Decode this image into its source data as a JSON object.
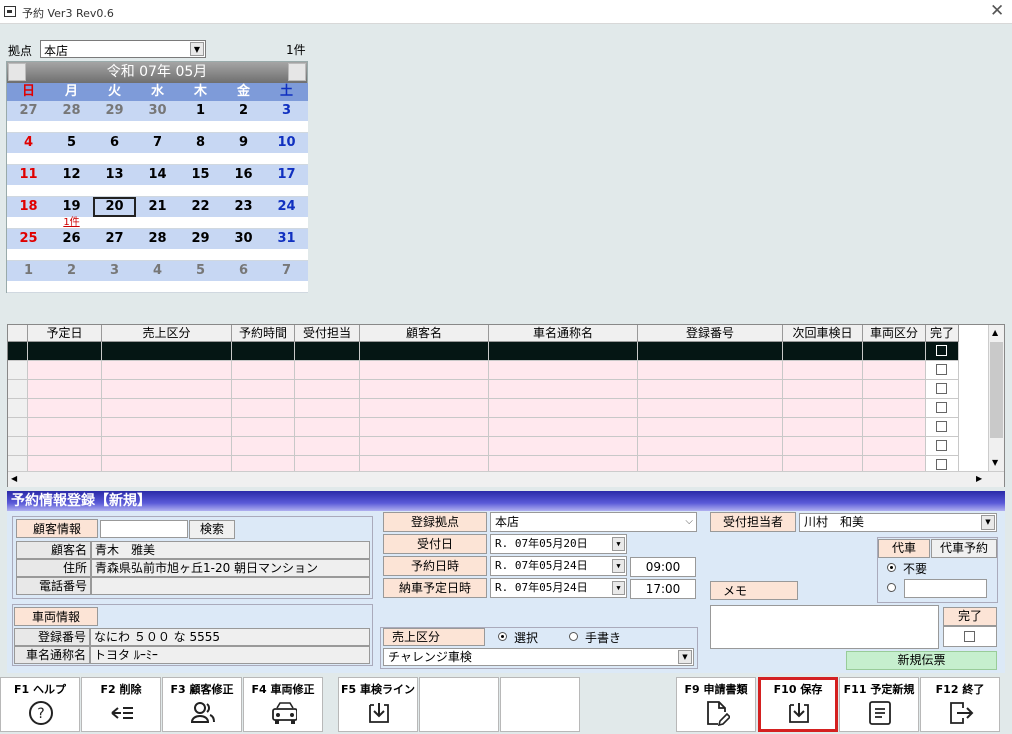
{
  "window": {
    "title": "予約 Ver3 Rev0.6",
    "close": "✕"
  },
  "top": {
    "branch_label": "拠点",
    "branch_value": "本店",
    "count": "1件"
  },
  "calendar": {
    "title": "令和 07年 05月",
    "dow": [
      "日",
      "月",
      "火",
      "水",
      "木",
      "金",
      "土"
    ],
    "weeks": [
      [
        {
          "d": "27",
          "o": 1
        },
        {
          "d": "28",
          "o": 1
        },
        {
          "d": "29",
          "o": 1
        },
        {
          "d": "30",
          "o": 1
        },
        {
          "d": "1"
        },
        {
          "d": "2"
        },
        {
          "d": "3"
        }
      ],
      [
        {
          "d": "4"
        },
        {
          "d": "5"
        },
        {
          "d": "6"
        },
        {
          "d": "7"
        },
        {
          "d": "8"
        },
        {
          "d": "9"
        },
        {
          "d": "10"
        }
      ],
      [
        {
          "d": "11"
        },
        {
          "d": "12"
        },
        {
          "d": "13"
        },
        {
          "d": "14"
        },
        {
          "d": "15"
        },
        {
          "d": "16"
        },
        {
          "d": "17"
        }
      ],
      [
        {
          "d": "18"
        },
        {
          "d": "19",
          "c": "1件"
        },
        {
          "d": "20",
          "s": 1
        },
        {
          "d": "21"
        },
        {
          "d": "22"
        },
        {
          "d": "23"
        },
        {
          "d": "24"
        }
      ],
      [
        {
          "d": "25"
        },
        {
          "d": "26"
        },
        {
          "d": "27"
        },
        {
          "d": "28"
        },
        {
          "d": "29"
        },
        {
          "d": "30"
        },
        {
          "d": "31"
        }
      ],
      [
        {
          "d": "1",
          "o": 1
        },
        {
          "d": "2",
          "o": 1
        },
        {
          "d": "3",
          "o": 1
        },
        {
          "d": "4",
          "o": 1
        },
        {
          "d": "5",
          "o": 1
        },
        {
          "d": "6",
          "o": 1
        },
        {
          "d": "7",
          "o": 1
        }
      ]
    ]
  },
  "grid": {
    "columns": [
      "予定日",
      "売上区分",
      "予約時間",
      "受付担当",
      "顧客名",
      "車名通称名",
      "登録番号",
      "次回車検日",
      "車両区分",
      "完了"
    ]
  },
  "form": {
    "title": "予約情報登録【新規】",
    "customer": {
      "header": "顧客情報",
      "search": "検索",
      "name_label": "顧客名",
      "name": "青木　雅美",
      "addr_label": "住所",
      "addr": "青森県弘前市旭ヶ丘1-20 朝日マンション",
      "tel_label": "電話番号",
      "tel": ""
    },
    "vehicle": {
      "header": "車両情報",
      "reg_label": "登録番号",
      "reg": "なにわ ５００ な 5555",
      "car_label": "車名通称名",
      "car": "トヨタ ﾙｰﾐｰ"
    },
    "center": {
      "branch_label": "登録拠点",
      "branch": "本店",
      "recv_label": "受付日",
      "recv": "R. 07年05月20日",
      "resv_label": "予約日時",
      "resv": "R. 07年05月24日",
      "resv_time": "09:00",
      "deliv_label": "納車予定日時",
      "deliv": "R. 07年05月24日",
      "deliv_time": "17:00"
    },
    "sales": {
      "label": "売上区分",
      "opt1": "選択",
      "opt2": "手書き",
      "value": "チャレンジ車検"
    },
    "right": {
      "staff_label": "受付担当者",
      "staff": "川村　和美",
      "daisha": "代車",
      "daisha_resv": "代車予約",
      "fuyou": "不要",
      "memo": "メモ",
      "kanryo": "完了",
      "new_slip": "新規伝票"
    }
  },
  "fkeys": [
    {
      "k": "F1 ヘルプ",
      "icon": "help-icon"
    },
    {
      "k": "F2 削除",
      "icon": "delete-icon"
    },
    {
      "k": "F3 顧客修正",
      "icon": "customer-icon"
    },
    {
      "k": "F4 車両修正",
      "icon": "car-icon"
    },
    {
      "k": "F5 車検ライン",
      "icon": "download-icon"
    },
    {
      "k": "",
      "icon": ""
    },
    {
      "k": "",
      "icon": ""
    },
    {
      "k": "F9 申請書類",
      "icon": "document-edit-icon"
    },
    {
      "k": "F10 保存",
      "icon": "save-icon"
    },
    {
      "k": "F11 予定新規",
      "icon": "list-icon"
    },
    {
      "k": "F12 終了",
      "icon": "exit-icon"
    }
  ]
}
